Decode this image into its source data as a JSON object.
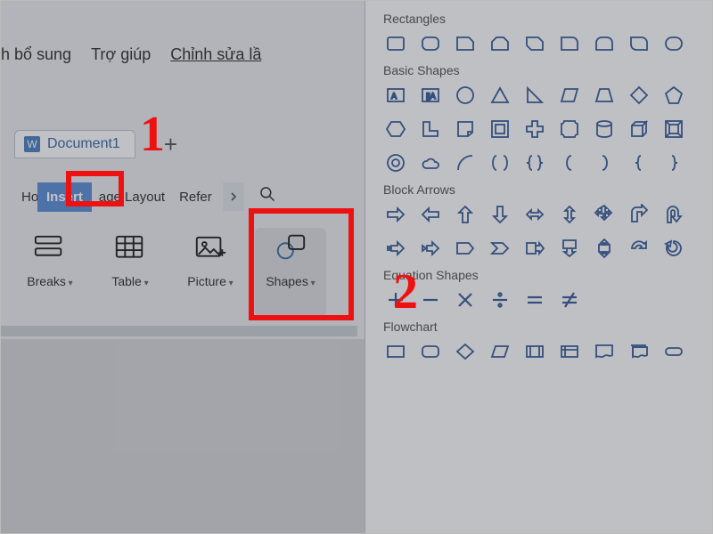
{
  "topbar": {
    "left_partial": "h bổ sung",
    "help": "Trợ giúp",
    "edit_partial": "Chỉnh sửa lầ"
  },
  "document": {
    "tab_name": "Document1",
    "new_tab": "+"
  },
  "ribbon": {
    "home_partial": "Home",
    "insert": "Insert",
    "page_layout_partial": "age Layout",
    "references_partial": "Refer"
  },
  "commands": {
    "breaks": "Breaks",
    "table": "Table",
    "picture": "Picture",
    "shapes": "Shapes"
  },
  "annotations": {
    "one": "1",
    "two": "2"
  },
  "panel": {
    "rectangles": "Rectangles",
    "basic_shapes": "Basic Shapes",
    "block_arrows": "Block Arrows",
    "equation_shapes": "Equation Shapes",
    "flowchart": "Flowchart"
  }
}
